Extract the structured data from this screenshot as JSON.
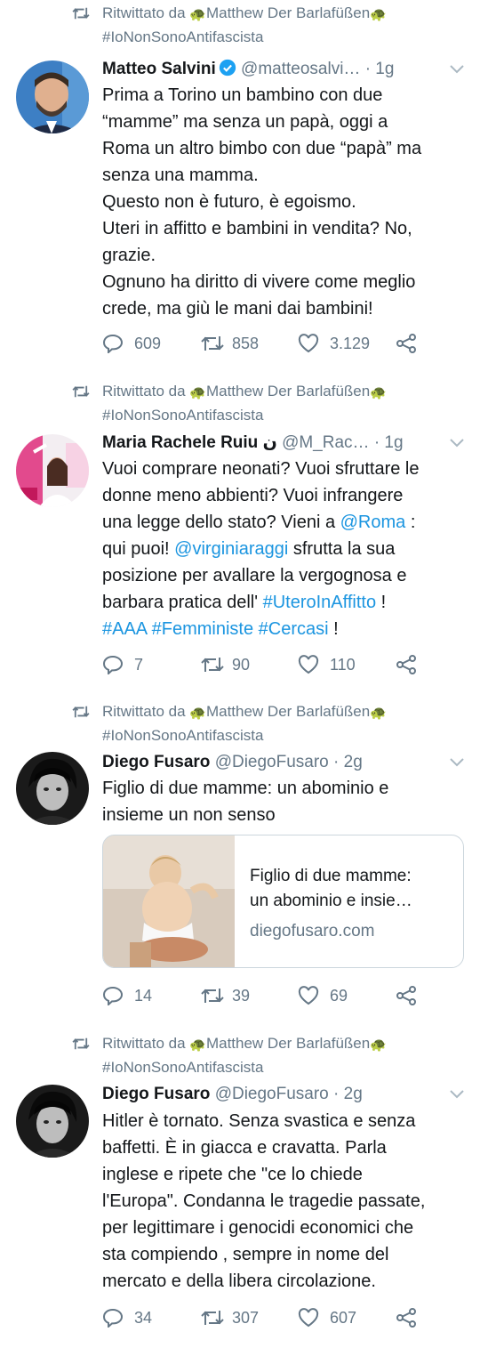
{
  "tweets": [
    {
      "retweet": {
        "prefix": "Ritwittato da ",
        "user": "Matthew Der Barlafüßen",
        "user2": "#IoNonSonoAntifascista"
      },
      "author": {
        "name": "Matteo Salvini",
        "handle": "@matteosalvi…",
        "time": " · 1g",
        "verified": true
      },
      "text": [
        "Prima a Torino un bambino con due",
        "“mamme” ma senza un papà, oggi a",
        "Roma un altro bimbo con due “papà” ma",
        "senza una mamma.",
        "Questo non è futuro, è egoismo.",
        "Uteri in affitto e bambini in vendita? No,",
        "grazie.",
        "Ognuno ha diritto di vivere come meglio",
        "crede, ma giù le mani dai bambini!"
      ],
      "stats": {
        "replies": "609",
        "retweets": "858",
        "likes": "3.129"
      }
    },
    {
      "retweet": {
        "prefix": "Ritwittato da ",
        "user": "Matthew Der Barlafüßen",
        "user2": "#IoNonSonoAntifascista"
      },
      "author": {
        "name": "Maria Rachele Ruiu",
        "name_suffix": " ن",
        "handle": "@M_Rac…",
        "time": " · 1g"
      },
      "text_rich": {
        "l1": "Vuoi comprare neonati? Vuoi sfruttare le",
        "l2": "donne meno abbienti? Vuoi infrangere",
        "l3a": "una legge dello stato? Vieni a ",
        "l3b": "@Roma",
        "l3c": " :",
        "l4a": "qui puoi! ",
        "l4b": "@virginiaraggi",
        "l4c": " sfrutta la sua",
        "l5": "posizione per avallare la vergognosa e",
        "l6a": "barbara pratica dell' ",
        "l6b": "#UteroInAffitto",
        "l6c": " !",
        "l7a": "#AAA",
        "l7b": "#Femministe",
        "l7c": "#Cercasi",
        "l7d": " !"
      },
      "stats": {
        "replies": "7",
        "retweets": "90",
        "likes": "110"
      }
    },
    {
      "retweet": {
        "prefix": "Ritwittato da ",
        "user": "Matthew Der Barlafüßen",
        "user2": "#IoNonSonoAntifascista"
      },
      "author": {
        "name": "Diego Fusaro",
        "handle": "@DiegoFusaro",
        "time": " · 2g"
      },
      "text": [
        "Figlio di due mamme: un abominio e",
        "insieme un non senso"
      ],
      "card": {
        "title1": "Figlio di due mamme:",
        "title2": "un abominio e insie…",
        "domain": "diegofusaro.com"
      },
      "stats": {
        "replies": "14",
        "retweets": "39",
        "likes": "69"
      }
    },
    {
      "retweet": {
        "prefix": "Ritwittato da ",
        "user": "Matthew Der Barlafüßen",
        "user2": "#IoNonSonoAntifascista"
      },
      "author": {
        "name": "Diego Fusaro",
        "handle": "@DiegoFusaro",
        "time": " · 2g"
      },
      "text": [
        "Hitler è tornato. Senza svastica e senza",
        "baffetti. È in giacca e cravatta. Parla",
        "inglese e ripete che \"ce lo chiede",
        "l'Europa\". Condanna le tragedie passate,",
        "per legittimare i genocidi economici che",
        "sta compiendo , sempre in nome del",
        "mercato e della libera circolazione."
      ],
      "stats": {
        "replies": "34",
        "retweets": "307",
        "likes": "607"
      }
    }
  ],
  "icons": {
    "retweet_context": "retweet-icon",
    "reply": "reply-icon",
    "retweet": "retweet-icon",
    "like": "heart-icon",
    "share": "share-icon",
    "caret": "chevron-down-icon",
    "verified": "verified-badge-icon",
    "turtle": "turtle-emoji"
  },
  "colors": {
    "link": "#1b95e0",
    "muted": "#657786",
    "text": "#14171a",
    "verified": "#1da1f2"
  }
}
